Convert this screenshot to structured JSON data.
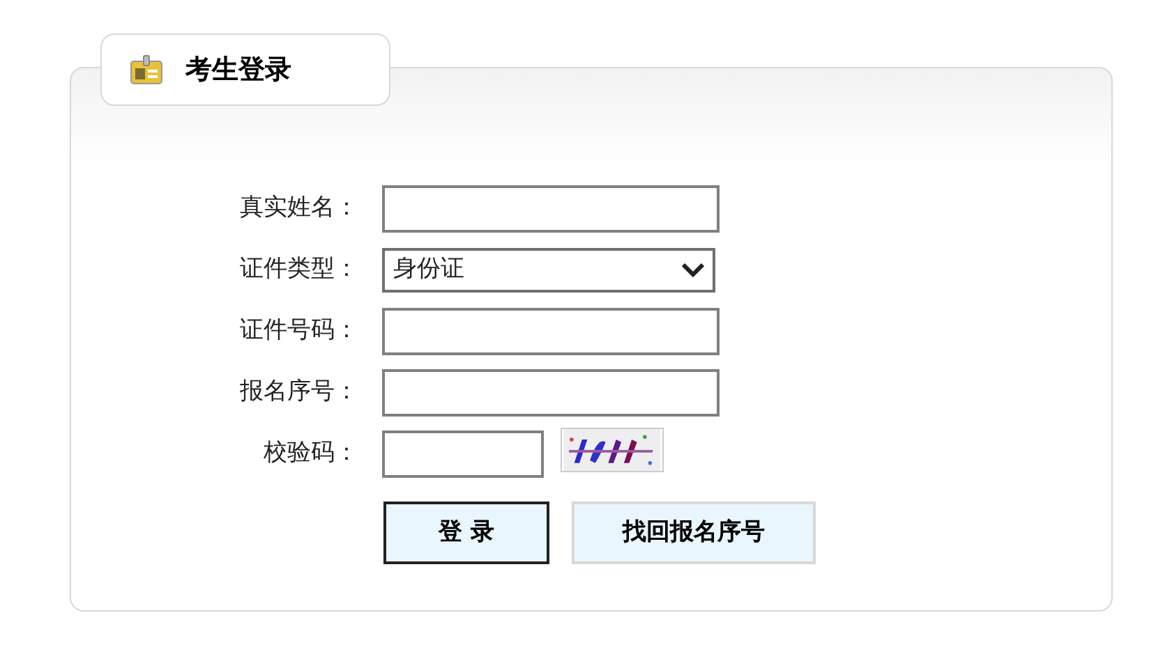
{
  "panel": {
    "title": "考生登录"
  },
  "fields": [
    {
      "label": "真实姓名：",
      "kind": "text"
    },
    {
      "label": "证件类型：",
      "kind": "select",
      "value": "身份证"
    },
    {
      "label": "证件号码：",
      "kind": "text"
    },
    {
      "label": "报名序号：",
      "kind": "text"
    },
    {
      "label": "校验码：",
      "kind": "captcha"
    }
  ],
  "buttons": [
    {
      "label": "登 录",
      "kind": "primary"
    },
    {
      "label": "找回报名序号",
      "kind": "secondary"
    }
  ]
}
